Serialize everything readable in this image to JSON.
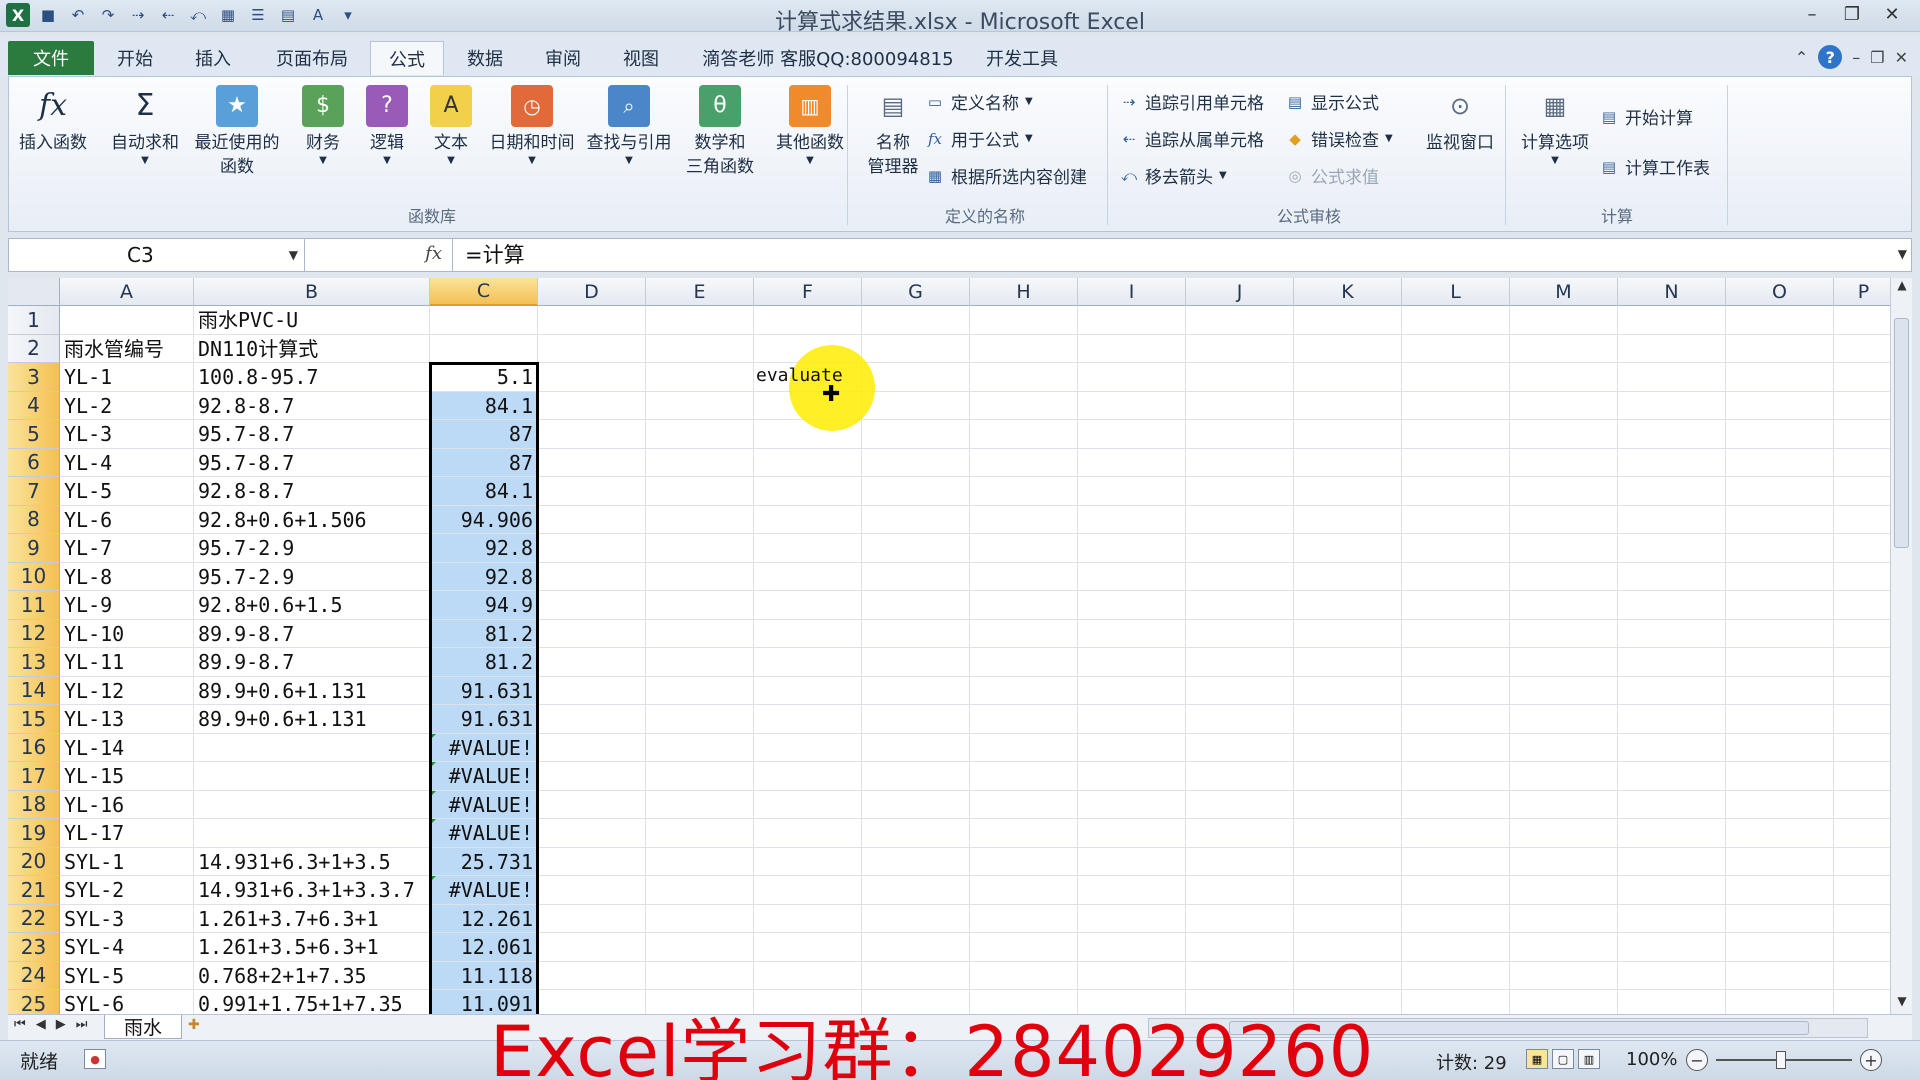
{
  "window": {
    "title": "计算式求结果.xlsx - Microsoft Excel"
  },
  "tabs": [
    {
      "label": "文件"
    },
    {
      "label": "开始"
    },
    {
      "label": "插入"
    },
    {
      "label": "页面布局"
    },
    {
      "label": "公式"
    },
    {
      "label": "数据"
    },
    {
      "label": "审阅"
    },
    {
      "label": "视图"
    },
    {
      "label": "滴答老师 客服QQ:800094815"
    },
    {
      "label": "开发工具"
    }
  ],
  "ribbon": {
    "function_library": {
      "label": "函数库",
      "buttons": [
        "插入函数",
        "自动求和",
        "最近使用的",
        "函数",
        "财务",
        "逻辑",
        "文本",
        "日期和时间",
        "查找与引用",
        "数学和",
        "三角函数",
        "其他函数"
      ]
    },
    "defined_names": {
      "label": "定义的名称",
      "name_manager": [
        "名称",
        "管理器"
      ],
      "define_name": "定义名称",
      "use_in_formula": "用于公式",
      "create_from_selection": "根据所选内容创建"
    },
    "formula_auditing": {
      "label": "公式审核",
      "trace_precedents": "追踪引用单元格",
      "trace_dependents": "追踪从属单元格",
      "remove_arrows": "移去箭头",
      "show_formulas": "显示公式",
      "error_checking": "错误检查",
      "evaluate_formula": "公式求值",
      "watch_window": "监视窗口"
    },
    "calculation": {
      "label": "计算",
      "calc_options": "计算选项",
      "calc_now": "开始计算",
      "calc_sheet": "计算工作表"
    }
  },
  "formula_bar": {
    "name_box": "C3",
    "formula": "=计算"
  },
  "columns": [
    "A",
    "B",
    "C",
    "D",
    "E",
    "F",
    "G",
    "H",
    "I",
    "J",
    "K",
    "L",
    "M",
    "N",
    "O",
    "P"
  ],
  "rows": [
    {
      "n": "1",
      "a": "",
      "b": "雨水PVC-U",
      "c": ""
    },
    {
      "n": "2",
      "a": "雨水管编号",
      "b": "DN110计算式",
      "c": ""
    },
    {
      "n": "3",
      "a": "YL-1",
      "b": "100.8-95.7",
      "c": "5.1"
    },
    {
      "n": "4",
      "a": "YL-2",
      "b": "92.8-8.7",
      "c": "84.1"
    },
    {
      "n": "5",
      "a": "YL-3",
      "b": "95.7-8.7",
      "c": "87"
    },
    {
      "n": "6",
      "a": "YL-4",
      "b": "95.7-8.7",
      "c": "87"
    },
    {
      "n": "7",
      "a": "YL-5",
      "b": "92.8-8.7",
      "c": "84.1"
    },
    {
      "n": "8",
      "a": "YL-6",
      "b": "92.8+0.6+1.506",
      "c": "94.906"
    },
    {
      "n": "9",
      "a": "YL-7",
      "b": "95.7-2.9",
      "c": "92.8"
    },
    {
      "n": "10",
      "a": "YL-8",
      "b": "95.7-2.9",
      "c": "92.8"
    },
    {
      "n": "11",
      "a": "YL-9",
      "b": "92.8+0.6+1.5",
      "c": "94.9"
    },
    {
      "n": "12",
      "a": "YL-10",
      "b": "89.9-8.7",
      "c": "81.2"
    },
    {
      "n": "13",
      "a": "YL-11",
      "b": "89.9-8.7",
      "c": "81.2"
    },
    {
      "n": "14",
      "a": "YL-12",
      "b": "89.9+0.6+1.131",
      "c": "91.631"
    },
    {
      "n": "15",
      "a": "YL-13",
      "b": "89.9+0.6+1.131",
      "c": "91.631"
    },
    {
      "n": "16",
      "a": "YL-14",
      "b": "",
      "c": "#VALUE!"
    },
    {
      "n": "17",
      "a": "YL-15",
      "b": "",
      "c": "#VALUE!"
    },
    {
      "n": "18",
      "a": "YL-16",
      "b": "",
      "c": "#VALUE!"
    },
    {
      "n": "19",
      "a": "YL-17",
      "b": "",
      "c": "#VALUE!"
    },
    {
      "n": "20",
      "a": "SYL-1",
      "b": "14.931+6.3+1+3.5",
      "c": "25.731"
    },
    {
      "n": "21",
      "a": "SYL-2",
      "b": "14.931+6.3+1+3.3.7",
      "c": "#VALUE!"
    },
    {
      "n": "22",
      "a": "SYL-3",
      "b": "1.261+3.7+6.3+1",
      "c": "12.261"
    },
    {
      "n": "23",
      "a": "SYL-4",
      "b": "1.261+3.5+6.3+1",
      "c": "12.061"
    },
    {
      "n": "24",
      "a": "SYL-5",
      "b": "0.768+2+1+7.35",
      "c": "11.118"
    },
    {
      "n": "25",
      "a": "SYL-6",
      "b": "0.991+1.75+1+7.35",
      "c": "11.091"
    }
  ],
  "floating_text": "evaluate",
  "sheet_tab": "雨水",
  "status": {
    "ready": "就绪",
    "count": "计数: 29",
    "zoom": "100%"
  },
  "watermark": "Excel学习群：284029260",
  "colors": {
    "accent_file_tab": "#2b7a3e",
    "selection_fill": "#bcd9f5",
    "watermark": "#e0000d"
  }
}
